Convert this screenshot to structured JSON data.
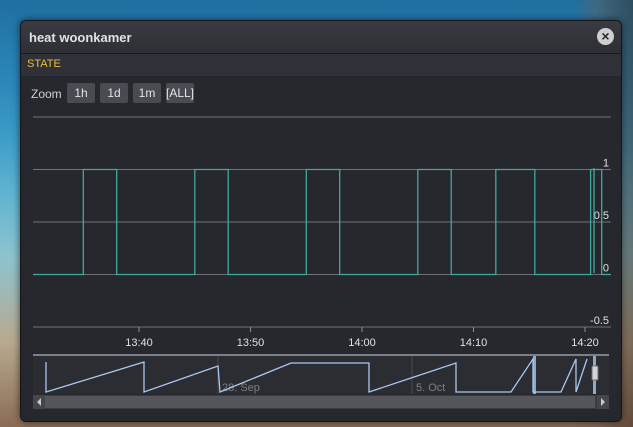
{
  "dialog": {
    "title": "heat woonkamer",
    "close_symbol": "×",
    "section_label": "STATE"
  },
  "zoom": {
    "label": "Zoom",
    "buttons": [
      "1h",
      "1d",
      "1m",
      "[ALL]"
    ]
  },
  "navigator": {
    "labels": [
      "28. Sep",
      "5. Oct"
    ]
  },
  "colors": {
    "line": "#3fa9a0",
    "navigator_line": "#a9c8ee",
    "grid": "#8a8b90",
    "accent": "#e8c23a"
  },
  "chart_data": {
    "type": "line",
    "step": true,
    "title": "",
    "xlabel": "",
    "ylabel": "",
    "ylim": [
      -0.5,
      1.5
    ],
    "y_ticks": [
      "1",
      "0.5",
      "0",
      "-0.5"
    ],
    "x_ticks": [
      "13:40",
      "13:50",
      "14:00",
      "14:10",
      "14:20"
    ],
    "series": [
      {
        "x": [
          "13:35",
          "13:35",
          "13:38",
          "13:38",
          "13:45",
          "13:45",
          "13:48",
          "13:48",
          "13:55",
          "13:55",
          "13:58",
          "13:58",
          "14:05",
          "14:05",
          "14:08",
          "14:08",
          "14:12",
          "14:12",
          "14:15.5",
          "14:15.5",
          "14:20.5",
          "14:20.5",
          "14:21.5",
          "14:21.5"
        ],
        "values": [
          0,
          1,
          1,
          0,
          0,
          1,
          1,
          0,
          0,
          1,
          1,
          0,
          0,
          1,
          1,
          0,
          0,
          1,
          1,
          0,
          0,
          1,
          1,
          0
        ]
      }
    ]
  }
}
